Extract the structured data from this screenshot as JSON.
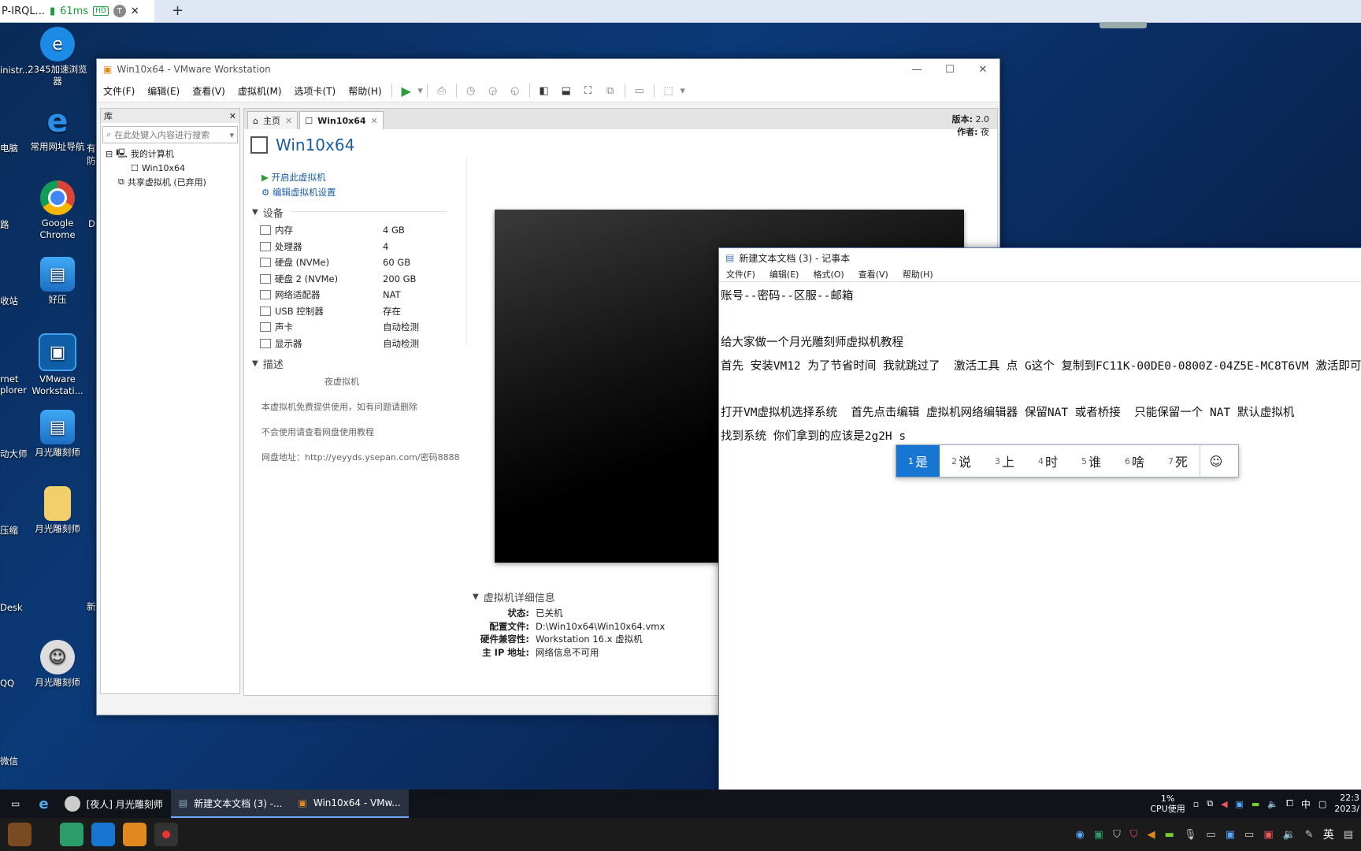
{
  "browser": {
    "tab_title": "P-IRQL...",
    "ping": "61ms",
    "hd_badge": "HD",
    "profile_letter": "T",
    "new_tab": "+"
  },
  "desktop": {
    "icons": [
      {
        "label": "2345加速浏览器",
        "icon": "browser-2345-icon"
      },
      {
        "label": "常用网址导航",
        "icon": "ie-icon"
      },
      {
        "label": "Google Chrome",
        "icon": "chrome-icon"
      },
      {
        "label": "好压",
        "icon": "haozip-icon"
      },
      {
        "label": "VMware Workstati...",
        "icon": "vmware-icon"
      },
      {
        "label": "月光雕刻师",
        "icon": "haozip-icon"
      },
      {
        "label": "月光雕刻师",
        "icon": "folder-icon"
      },
      {
        "label": "月光雕刻师",
        "icon": "avatar-icon"
      }
    ],
    "partial_left": [
      "inistr...",
      "电脑",
      "路",
      "收站",
      "rnet plorer",
      "动大师",
      "压缩",
      "Desk",
      "QQ",
      "微信"
    ],
    "partial_mid": [
      "有防",
      "D",
      "新"
    ]
  },
  "vmware": {
    "title": "Win10x64 - VMware Workstation",
    "menu": [
      "文件(F)",
      "编辑(E)",
      "查看(V)",
      "虚拟机(M)",
      "选项卡(T)",
      "帮助(H)"
    ],
    "library": {
      "header": "库",
      "search_placeholder": "在此处键入内容进行搜索",
      "tree": [
        "我的计算机",
        "Win10x64",
        "共享虚拟机 (已弃用)"
      ]
    },
    "tabs": [
      "主页",
      "Win10x64"
    ],
    "vm_name": "Win10x64",
    "actions": [
      "开启此虚拟机",
      "编辑虚拟机设置"
    ],
    "devices_header": "设备",
    "devices": [
      {
        "name": "内存",
        "value": "4 GB"
      },
      {
        "name": "处理器",
        "value": "4"
      },
      {
        "name": "硬盘 (NVMe)",
        "value": "60 GB"
      },
      {
        "name": "硬盘 2 (NVMe)",
        "value": "200 GB"
      },
      {
        "name": "网络适配器",
        "value": "NAT"
      },
      {
        "name": "USB 控制器",
        "value": "存在"
      },
      {
        "name": "声卡",
        "value": "自动检测"
      },
      {
        "name": "显示器",
        "value": "自动检测"
      }
    ],
    "description_header": "描述",
    "description": [
      "夜虚拟机",
      "本虚拟机免费提供使用，如有问题请删除",
      "不会使用请查看网盘使用教程",
      "网盘地址：http://yeyyds.ysepan.com/密码8888"
    ],
    "version_key": "版本:",
    "version_val": "2.0",
    "author_key": "作者:",
    "author_val": "夜",
    "details_header": "虚拟机详细信息",
    "details": [
      {
        "k": "状态:",
        "v": "已关机"
      },
      {
        "k": "配置文件:",
        "v": "D:\\Win10x64\\Win10x64.vmx"
      },
      {
        "k": "硬件兼容性:",
        "v": "Workstation 16.x 虚拟机"
      },
      {
        "k": "主 IP 地址:",
        "v": "网络信息不可用"
      }
    ]
  },
  "notepad": {
    "title": "新建文本文档 (3) - 记事本",
    "menu": [
      "文件(F)",
      "编辑(E)",
      "格式(O)",
      "查看(V)",
      "帮助(H)"
    ],
    "lines": [
      "账号--密码--区服--邮箱",
      "",
      "给大家做一个月光雕刻师虚拟机教程",
      "首先 安装VM12 为了节省时间 我就跳过了  激活工具 点 G这个 复制到FC11K-00DE0-0800Z-04Z5E-MC8T6VM 激活即可",
      "",
      "打开VM虚拟机选择系统  首先点击编辑 虚拟机网络编辑器 保留NAT 或者桥接  只能保留一个 NAT 默认虚拟机",
      "找到系统 你们拿到的应该是2g2H s"
    ]
  },
  "ime": {
    "candidates": [
      {
        "n": "1",
        "c": "是"
      },
      {
        "n": "2",
        "c": "说"
      },
      {
        "n": "3",
        "c": "上"
      },
      {
        "n": "4",
        "c": "时"
      },
      {
        "n": "5",
        "c": "谁"
      },
      {
        "n": "6",
        "c": "啥"
      },
      {
        "n": "7",
        "c": "死"
      }
    ],
    "emoji": "☺"
  },
  "taskbar": {
    "items": [
      "[夜人] 月光雕刻师",
      "新建文本文档 (3) -...",
      "Win10x64 - VMw..."
    ],
    "cpu_percent": "1%",
    "cpu_label": "CPU使用",
    "lang": "中",
    "ime_mode": "英",
    "time": "22:3",
    "date": "2023/"
  }
}
